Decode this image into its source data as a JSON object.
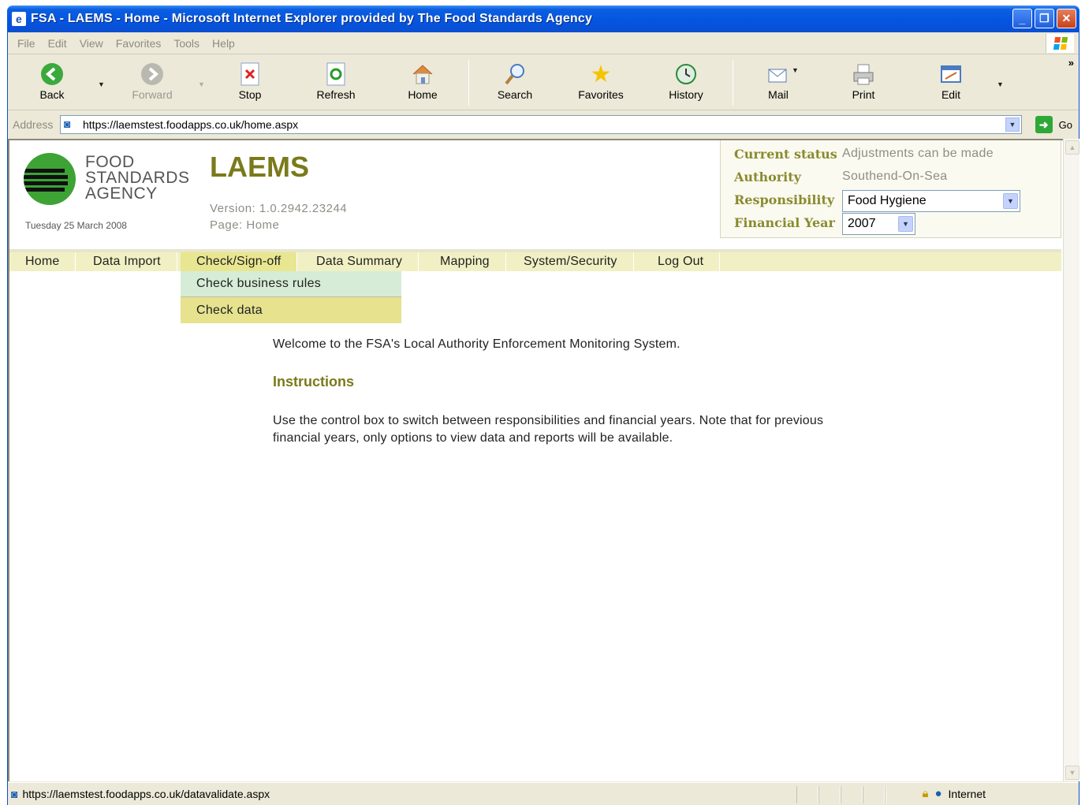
{
  "window": {
    "title": "FSA - LAEMS - Home - Microsoft Internet Explorer provided by The Food Standards Agency"
  },
  "menubar": [
    "File",
    "Edit",
    "View",
    "Favorites",
    "Tools",
    "Help"
  ],
  "toolbar": {
    "back": "Back",
    "forward": "Forward",
    "stop": "Stop",
    "refresh": "Refresh",
    "home": "Home",
    "search": "Search",
    "favorites": "Favorites",
    "history": "History",
    "mail": "Mail",
    "print": "Print",
    "edit": "Edit"
  },
  "address": {
    "label": "Address",
    "url": "https://laemstest.foodapps.co.uk/home.aspx",
    "go": "Go"
  },
  "page": {
    "logo_lines": [
      "FOOD",
      "STANDARDS",
      "AGENCY"
    ],
    "date": "Tuesday 25 March 2008",
    "app_title": "LAEMS",
    "version": "Version: 1.0.2942.23244",
    "page_name": "Page: Home",
    "status": {
      "current_status_label": "Current status",
      "current_status_value": "Adjustments can be made",
      "authority_label": "Authority",
      "authority_value": "Southend-On-Sea",
      "responsibility_label": "Responsibility",
      "responsibility_value": "Food Hygiene",
      "financial_year_label": "Financial Year",
      "financial_year_value": "2007"
    },
    "nav": [
      "Home",
      "Data Import",
      "Check/Sign-off",
      "Data Summary",
      "Mapping",
      "System/Security",
      "Log Out"
    ],
    "submenu": [
      "Check business rules",
      "Check data"
    ],
    "welcome": "Welcome to the FSA's Local Authority Enforcement Monitoring System.",
    "instructions_title": "Instructions",
    "instructions_text": "Use the control box to switch between responsibilities and financial years. Note that for previous financial years, only options to view data and reports will be available."
  },
  "statusbar": {
    "url": "https://laemstest.foodapps.co.uk/datavalidate.aspx",
    "zone": "Internet"
  },
  "colors": {
    "accent_olive": "#7a7a1a",
    "nav_bg": "#f0f0c4",
    "nav_active": "#e8e690",
    "submenu_first": "#d6ecd6",
    "xp_title": "#0554e0"
  }
}
